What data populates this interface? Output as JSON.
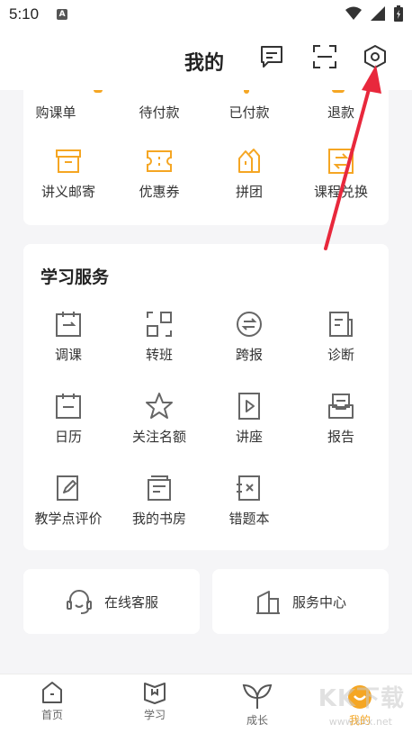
{
  "status_bar": {
    "time": "5:10",
    "notif_letter": "A"
  },
  "header": {
    "title": "我的"
  },
  "order_card": {
    "row1": [
      {
        "label": "购课单",
        "icon": "cart-icon"
      },
      {
        "label": "待付款",
        "icon": "wallet-icon"
      },
      {
        "label": "已付款",
        "icon": "check-icon"
      },
      {
        "label": "退款",
        "icon": "refund-icon"
      }
    ],
    "row2": [
      {
        "label": "讲义邮寄",
        "icon": "package-icon"
      },
      {
        "label": "优惠券",
        "icon": "coupon-icon"
      },
      {
        "label": "拼团",
        "icon": "group-buy-icon"
      },
      {
        "label": "课程兑换",
        "icon": "exchange-icon"
      }
    ]
  },
  "study_services": {
    "title": "学习服务",
    "items": [
      {
        "label": "调课",
        "icon": "calendar-swap-icon"
      },
      {
        "label": "转班",
        "icon": "transfer-icon"
      },
      {
        "label": "跨报",
        "icon": "switch-icon"
      },
      {
        "label": "诊断",
        "icon": "diagnosis-icon"
      },
      {
        "label": "日历",
        "icon": "calendar-icon"
      },
      {
        "label": "关注名额",
        "icon": "star-icon"
      },
      {
        "label": "讲座",
        "icon": "play-icon"
      },
      {
        "label": "报告",
        "icon": "report-icon"
      },
      {
        "label": "教学点评价",
        "icon": "edit-icon"
      },
      {
        "label": "我的书房",
        "icon": "book-icon"
      },
      {
        "label": "错题本",
        "icon": "mistake-book-icon"
      }
    ]
  },
  "support": {
    "online_service": "在线客服",
    "service_center": "服务中心"
  },
  "tabs": [
    {
      "label": "首页",
      "icon": "home-icon"
    },
    {
      "label": "学习",
      "icon": "study-icon"
    },
    {
      "label": "成长",
      "icon": "sprout-icon"
    },
    {
      "label": "我的",
      "icon": "profile-icon"
    }
  ],
  "watermark": {
    "text": "KK下载",
    "sub": "www.kkx.net"
  },
  "colors": {
    "accent": "#f5a623",
    "icon_gray": "#666666",
    "arrow_red": "#e8283c"
  }
}
